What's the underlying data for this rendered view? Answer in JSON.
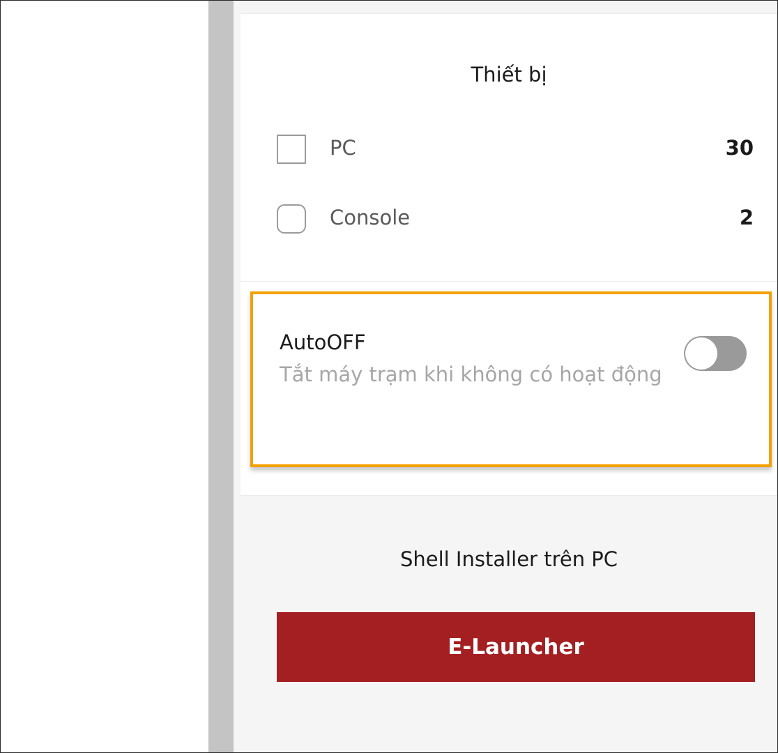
{
  "colors": {
    "accent_highlight": "#f2a100",
    "button_bg": "#a41f22",
    "toggle_off": "#9a9a9a",
    "panel_bg": "#f5f5f5",
    "scroll_strip": "#c4c4c4"
  },
  "devices": {
    "title": "Thiết bị",
    "items": [
      {
        "label": "PC",
        "count": "30",
        "checked": false
      },
      {
        "label": "Console",
        "count": "2",
        "checked": false
      }
    ]
  },
  "autooff": {
    "title": "AutoOFF",
    "description": "Tắt máy trạm khi không có hoạt động",
    "enabled": false
  },
  "installer": {
    "title": "Shell Installer trên PC",
    "button_label": "E-Launcher"
  }
}
